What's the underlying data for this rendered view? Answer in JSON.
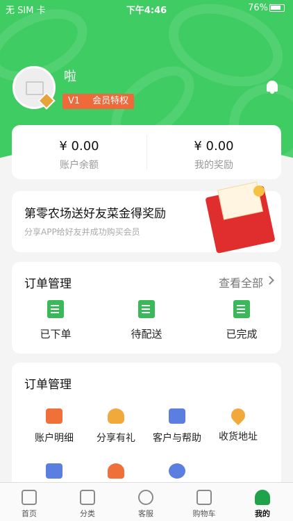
{
  "status_bar": {
    "carrier": "无 SIM 卡",
    "time": "下午4:46",
    "battery": "76%"
  },
  "profile": {
    "username": "啦",
    "level": "V1",
    "privilege": "会员特权"
  },
  "balance": {
    "account_amount": "¥ 0.00",
    "account_label": "账户余额",
    "reward_amount": "¥ 0.00",
    "reward_label": "我的奖励"
  },
  "promo": {
    "title": "第零农场送好友菜金得奖励",
    "subtitle": "分享APP给好友并成功购买会员"
  },
  "orders": {
    "title": "订单管理",
    "see_all": "查看全部",
    "items": [
      {
        "label": "已下单",
        "icon": "order-placed-icon"
      },
      {
        "label": "待配送",
        "icon": "pending-delivery-icon"
      },
      {
        "label": "已完成",
        "icon": "order-complete-icon"
      }
    ]
  },
  "tools": {
    "title": "订单管理",
    "items": [
      {
        "label": "账户明细",
        "icon": "wallet-icon",
        "color": "#f0703a"
      },
      {
        "label": "分享有礼",
        "icon": "money-bag-icon",
        "color": "#f2a93b"
      },
      {
        "label": "客户与帮助",
        "icon": "help-icon",
        "color": "#5a7fe0"
      },
      {
        "label": "收货地址",
        "icon": "location-icon",
        "color": "#f2a93b"
      },
      {
        "label": "",
        "icon": "bookmark-icon",
        "color": "#5a7fe0"
      },
      {
        "label": "",
        "icon": "users-icon",
        "color": "#f0703a"
      },
      {
        "label": "",
        "icon": "gear-icon",
        "color": "#5a7fe0"
      }
    ]
  },
  "tabbar": [
    {
      "label": "首页",
      "icon": "home-icon"
    },
    {
      "label": "分类",
      "icon": "category-icon"
    },
    {
      "label": "客服",
      "icon": "service-icon"
    },
    {
      "label": "购物车",
      "icon": "cart-icon"
    },
    {
      "label": "我的",
      "icon": "profile-icon",
      "active": true
    }
  ],
  "colors": {
    "brand_green": "#3fcc62",
    "badge_orange": "#ee6a3b"
  }
}
